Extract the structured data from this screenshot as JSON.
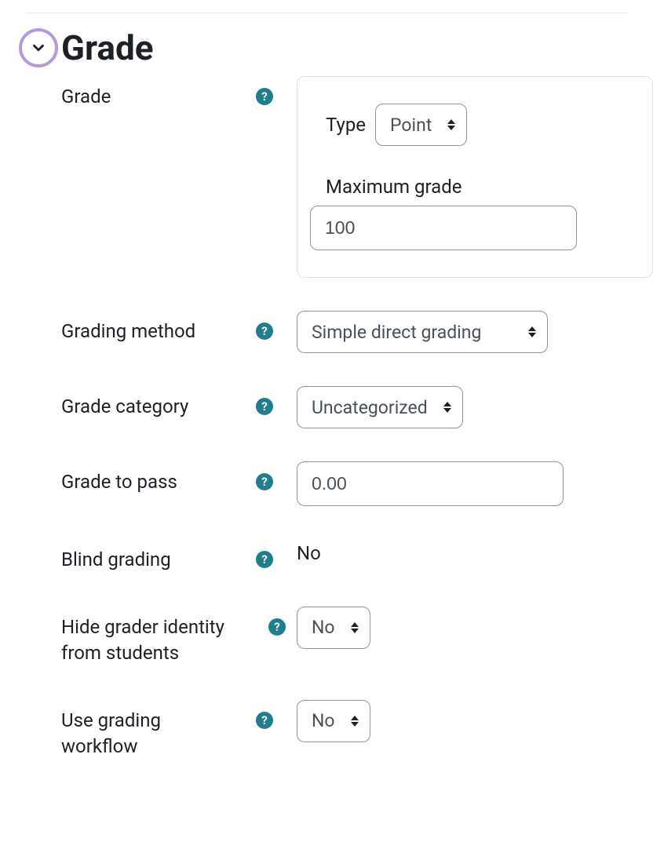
{
  "section": {
    "title": "Grade"
  },
  "fields": {
    "grade": {
      "label": "Grade",
      "type_label": "Type",
      "type_value": "Point",
      "max_label": "Maximum grade",
      "max_value": "100"
    },
    "method": {
      "label": "Grading method",
      "value": "Simple direct grading"
    },
    "category": {
      "label": "Grade category",
      "value": "Uncategorized"
    },
    "pass": {
      "label": "Grade to pass",
      "value": "0.00"
    },
    "blind": {
      "label": "Blind grading",
      "value": "No"
    },
    "hide": {
      "label": "Hide grader identity from students",
      "value": "No"
    },
    "workflow": {
      "label": "Use grading workflow",
      "value": "No"
    }
  }
}
